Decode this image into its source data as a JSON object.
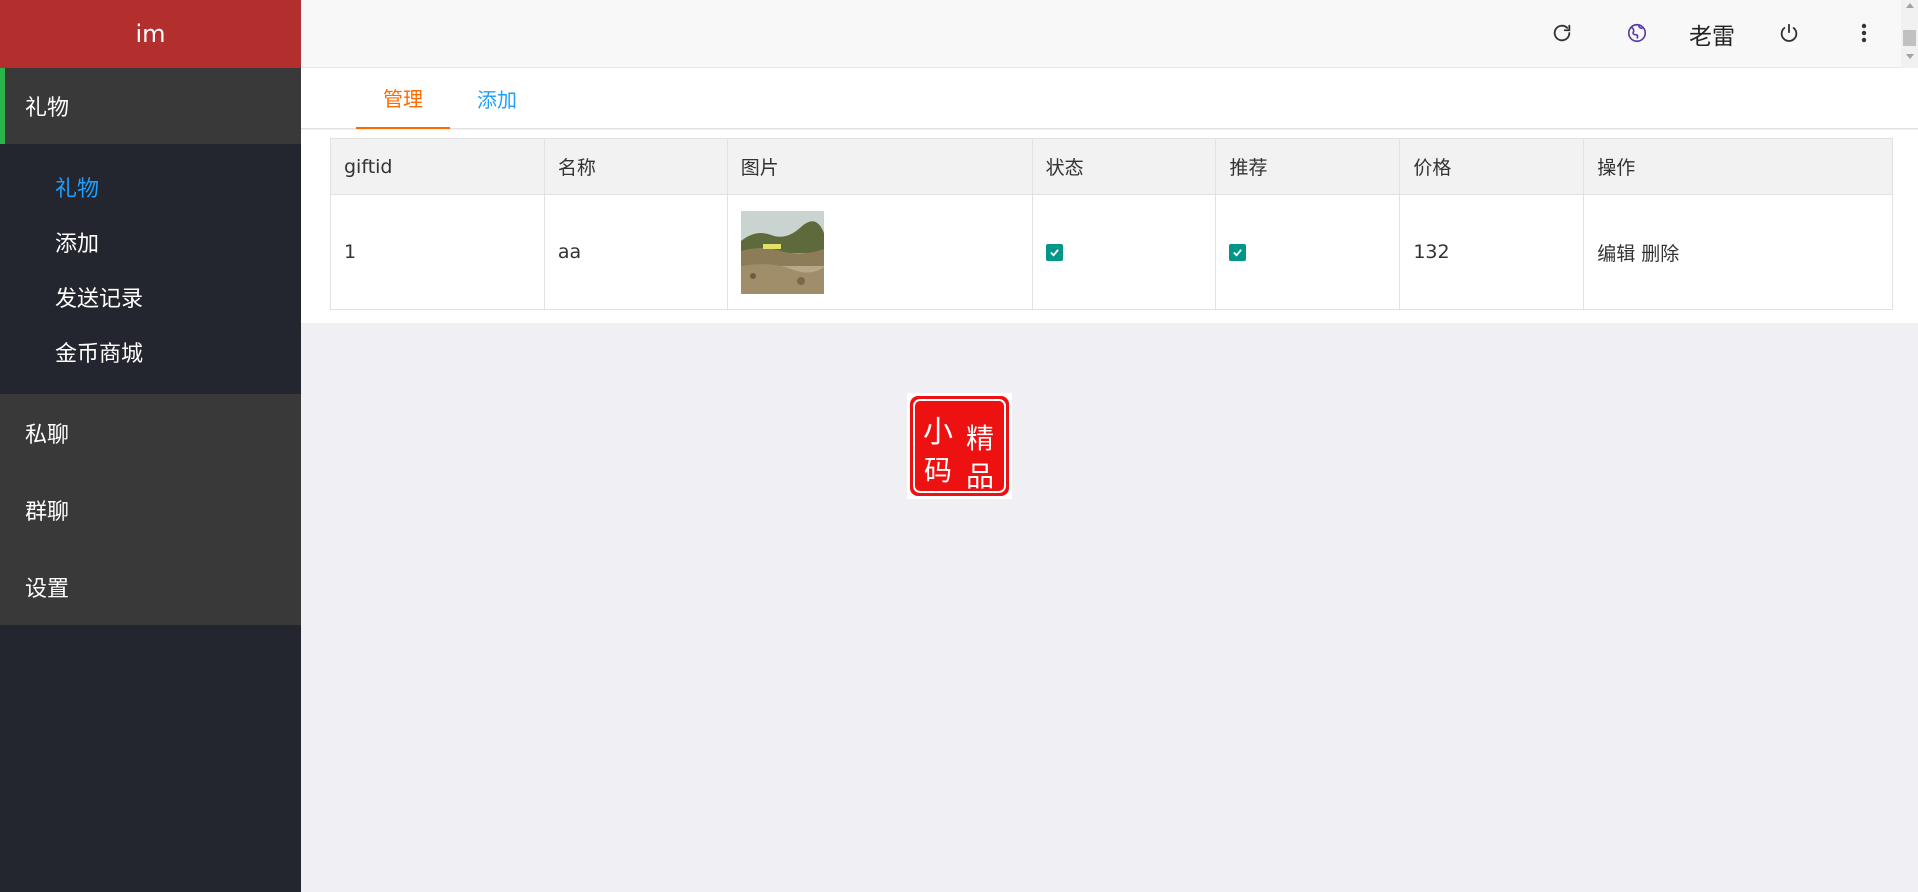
{
  "app": {
    "brand": "im"
  },
  "sidebar": {
    "groups": [
      {
        "label": "礼物",
        "active": true,
        "items": [
          {
            "label": "礼物",
            "active": true
          },
          {
            "label": "添加"
          },
          {
            "label": "发送记录"
          },
          {
            "label": "金币商城"
          }
        ]
      },
      {
        "label": "私聊"
      },
      {
        "label": "群聊"
      },
      {
        "label": "设置"
      }
    ]
  },
  "header": {
    "icons": [
      "refresh-icon",
      "globe-icon",
      "power-icon",
      "more-vertical-icon"
    ],
    "username": "老雷"
  },
  "tabs": [
    {
      "label": "管理",
      "active": true
    },
    {
      "label": "添加"
    }
  ],
  "table": {
    "columns": [
      "giftid",
      "名称",
      "图片",
      "状态",
      "推荐",
      "价格",
      "操作"
    ],
    "rows": [
      {
        "giftid": "1",
        "name": "aa",
        "image": "landscape-thumbnail",
        "status": true,
        "recommend": true,
        "price": "132",
        "actions": [
          "编辑",
          "删除"
        ]
      }
    ]
  },
  "seal": {
    "text": [
      "小",
      "精",
      "码",
      "品"
    ]
  },
  "colors": {
    "brand": "#b22f2e",
    "accent_tab": "#ff6a00",
    "link": "#1e9fff",
    "check": "#009688",
    "sidebar": "#23262e"
  }
}
